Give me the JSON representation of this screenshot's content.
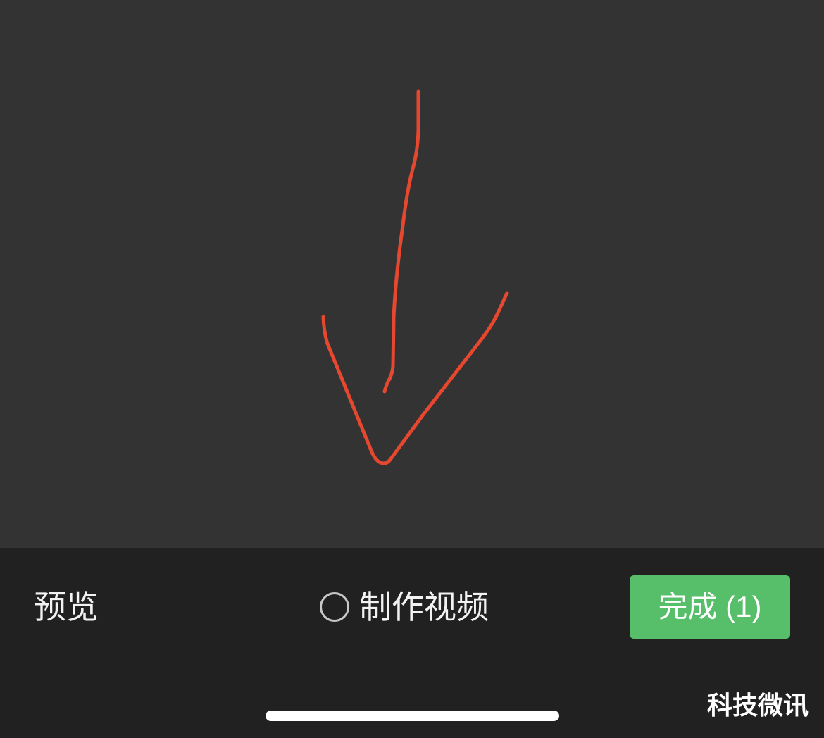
{
  "drawing": {
    "stroke_color": "#e5472f",
    "canvas_color": "#333333"
  },
  "toolbar": {
    "preview_label": "预览",
    "make_video_label": "制作视频",
    "make_video_checked": false,
    "done_label": "完成",
    "done_count": "(1)",
    "done_color": "#57be6a"
  },
  "watermark": {
    "text": "科技微讯"
  }
}
